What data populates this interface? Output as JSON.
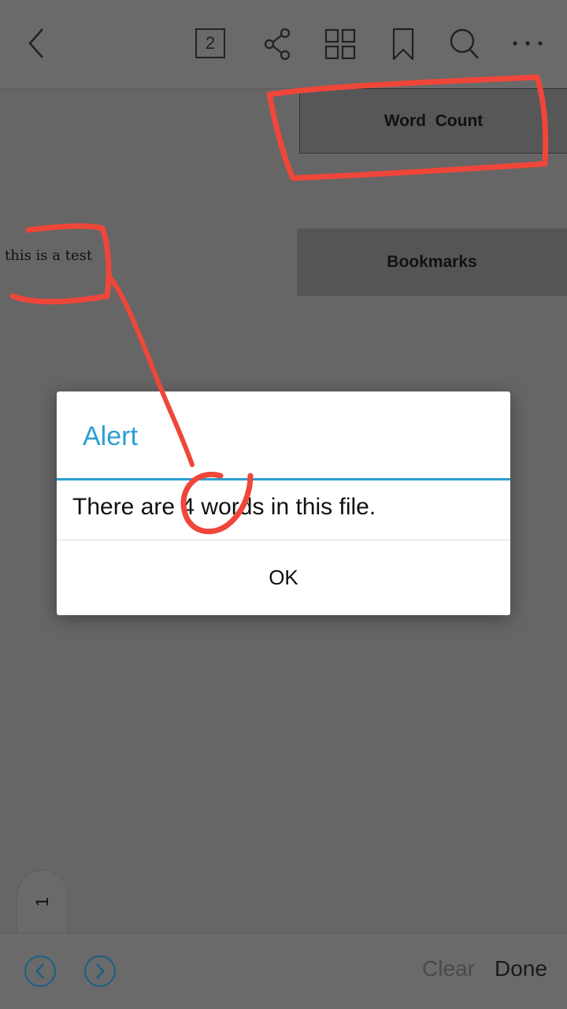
{
  "toolbar": {
    "page_number": "2",
    "icons": [
      "back-icon",
      "page-number-icon",
      "share-icon",
      "grid-icon",
      "bookmark-icon",
      "search-icon",
      "more-icon"
    ]
  },
  "panel": {
    "word_count_label": "Word  Count",
    "bookmarks_label": "Bookmarks"
  },
  "document": {
    "text": "this is a test"
  },
  "page_tab": {
    "label": "1"
  },
  "bottom_bar": {
    "clear_label": "Clear",
    "done_label": "Done",
    "clear_color": "#4a4a4a",
    "done_color": "#1a1a1a"
  },
  "dialog": {
    "title": "Alert",
    "message": "There are 4 words in this file.",
    "ok_label": "OK",
    "accent_color": "#2a9fd0"
  },
  "annotation": {
    "color": "#f0463a"
  }
}
